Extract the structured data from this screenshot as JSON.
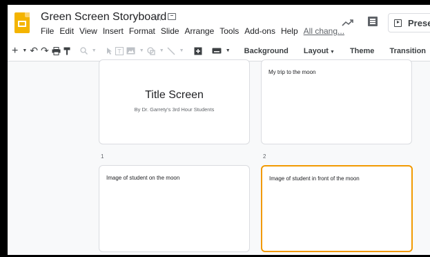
{
  "header": {
    "title": "Green Screen Storyboard",
    "star_icon": "star-icon",
    "folder_icon": "folder-icon",
    "present_label": "Present"
  },
  "menu": {
    "file": "File",
    "edit": "Edit",
    "view": "View",
    "insert": "Insert",
    "format": "Format",
    "slide": "Slide",
    "arrange": "Arrange",
    "tools": "Tools",
    "addons": "Add-ons",
    "help": "Help",
    "last_edit": "All chang..."
  },
  "toolbar": {
    "background": "Background",
    "layout": "Layout",
    "theme": "Theme",
    "transition": "Transition"
  },
  "slides": [
    {
      "number": "1",
      "title": "Title Screen",
      "subtitle": "By Dr. Garrety's 3rd Hour Students"
    },
    {
      "number": "2",
      "text": "My trip to the moon"
    },
    {
      "text": "Image of student on the moon"
    },
    {
      "text": "Image of student in front of the moon"
    }
  ],
  "colors": {
    "accent": "#f4b400",
    "selected_border": "#f29900"
  }
}
